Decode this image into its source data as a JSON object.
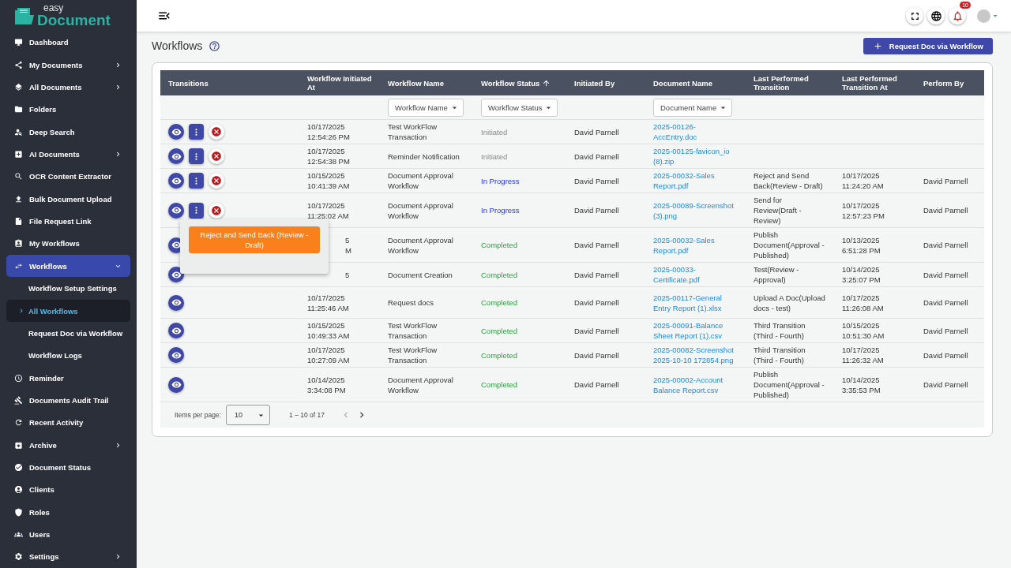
{
  "brand": {
    "small": "easy",
    "large": "Document"
  },
  "sidebar": {
    "items": [
      {
        "label": "Dashboard",
        "submenu": false
      },
      {
        "label": "My Documents",
        "submenu": true
      },
      {
        "label": "All Documents",
        "submenu": true
      },
      {
        "label": "Folders",
        "submenu": false
      },
      {
        "label": "Deep Search",
        "submenu": false
      },
      {
        "label": "AI Documents",
        "submenu": true
      },
      {
        "label": "OCR Content Extractor",
        "submenu": false
      },
      {
        "label": "Bulk Document Upload",
        "submenu": false
      },
      {
        "label": "File Request Link",
        "submenu": false
      },
      {
        "label": "My Workflows",
        "submenu": false
      },
      {
        "label": "Workflows",
        "submenu": true,
        "expanded": true,
        "children": [
          {
            "label": "Workflow Setup Settings",
            "selected": false
          },
          {
            "label": "All Workflows",
            "selected": true
          },
          {
            "label": "Request Doc via Workflow",
            "selected": false
          },
          {
            "label": "Workflow Logs",
            "selected": false
          }
        ]
      },
      {
        "label": "Reminder",
        "submenu": false
      },
      {
        "label": "Documents Audit Trail",
        "submenu": false
      },
      {
        "label": "Recent Activity",
        "submenu": false
      },
      {
        "label": "Archive",
        "submenu": true
      },
      {
        "label": "Document Status",
        "submenu": false
      },
      {
        "label": "Clients",
        "submenu": false
      },
      {
        "label": "Roles",
        "submenu": false
      },
      {
        "label": "Users",
        "submenu": false
      },
      {
        "label": "Settings",
        "submenu": true
      }
    ]
  },
  "topbar": {
    "notifications": "10"
  },
  "page": {
    "title": "Workflows",
    "action": "Request Doc via Workflow"
  },
  "table": {
    "columns": [
      {
        "label": "Transitions",
        "sorted": false
      },
      {
        "label": "Workflow Initiated At",
        "sorted": false
      },
      {
        "label": "Workflow Name",
        "sorted": false,
        "filter": "Workflow Name"
      },
      {
        "label": "Workflow Status",
        "sorted": true,
        "filter": "Workflow Status"
      },
      {
        "label": "Initiated By",
        "sorted": false
      },
      {
        "label": "Document Name",
        "sorted": false,
        "filter": "Document Name"
      },
      {
        "label": "Last Performed Transition",
        "sorted": false
      },
      {
        "label": "Last Performed Transition At",
        "sorted": false
      },
      {
        "label": "Perform By",
        "sorted": false
      }
    ],
    "rows": [
      {
        "transition": true,
        "cancel": true,
        "initiated_at": "10/17/2025 12:54:26 PM",
        "name": "Test WorkFlow Transaction",
        "status": "Initiated",
        "kind": "initiated",
        "by": "David Parnell",
        "document": "2025-00126-AccEntry.doc"
      },
      {
        "transition": true,
        "cancel": true,
        "initiated_at": "10/17/2025 12:54:38 PM",
        "name": "Reminder Notification",
        "status": "Initiated",
        "kind": "initiated",
        "by": "David Parnell",
        "document": "2025-00125-favicon_io (8).zip"
      },
      {
        "transition": true,
        "cancel": true,
        "initiated_at": "10/15/2025 10:41:39 AM",
        "name": "Document Approval Workflow",
        "status": "In Progress",
        "kind": "progress",
        "by": "David Parnell",
        "document": "2025-00032-Sales Report.pdf",
        "last": "Reject and Send Back(Review - Draft)",
        "last_at": "10/17/2025 11:24:20 AM",
        "perform_by": "David Parnell"
      },
      {
        "transition": true,
        "cancel": true,
        "menu_open": true,
        "menu": [
          "Reject and Send Back (Review - Draft)"
        ],
        "initiated_at": "10/17/2025 11:25:02 AM",
        "name": "Document Approval Workflow",
        "status": "In Progress",
        "kind": "progress",
        "by": "David Parnell",
        "document": "2025-00089-Screenshot (3).png",
        "last": "Send for Review(Draft - Review)",
        "last_at": "10/17/2025 12:57:23 PM",
        "perform_by": "David Parnell"
      },
      {
        "transition": false,
        "cancel": false,
        "covered": true,
        "initiated_at_parts": [
          "5",
          "M"
        ],
        "name": "Document Approval Workflow",
        "status": "Completed",
        "kind": "completed",
        "by": "David Parnell",
        "document": "2025-00032-Sales Report.pdf",
        "last": "Publish Document(Approval - Published)",
        "last_at": "10/13/2025 6:51:28 PM",
        "perform_by": "David Parnell"
      },
      {
        "transition": false,
        "cancel": false,
        "covered": true,
        "initiated_at_parts": [
          "5"
        ],
        "name": "Document Creation",
        "status": "Completed",
        "kind": "completed",
        "by": "David Parnell",
        "document": "2025-00033-Certificate.pdf",
        "last": "Test(Review - Approval)",
        "last_at": "10/14/2025 3:25:07 PM",
        "perform_by": "David Parnell"
      },
      {
        "transition": false,
        "cancel": false,
        "initiated_at": "10/17/2025 11:25:46 AM",
        "name": "Request docs",
        "status": "Completed",
        "kind": "completed",
        "by": "David Parnell",
        "document": "2025-00117-General Entry Report (1).xlsx",
        "last": "Upload A Doc(Upload docs - test)",
        "last_at": "10/17/2025 11:26:08 AM",
        "perform_by": "David Parnell"
      },
      {
        "transition": false,
        "cancel": false,
        "initiated_at": "10/15/2025 10:49:33 AM",
        "name": "Test WorkFlow Transaction",
        "status": "Completed",
        "kind": "completed",
        "by": "David Parnell",
        "document": "2025-00091-Balance Sheet Report (1).csv",
        "last": "Third Transition (Third - Fourth)",
        "last_at": "10/15/2025 10:51:30 AM",
        "perform_by": "David Parnell"
      },
      {
        "transition": false,
        "cancel": false,
        "initiated_at": "10/17/2025 10:27:09 AM",
        "name": "Test WorkFlow Transaction",
        "status": "Completed",
        "kind": "completed",
        "by": "David Parnell",
        "document": "2025-00082-Screenshot 2025-10-10 172854.png",
        "last": "Third Transition (Third - Fourth)",
        "last_at": "10/17/2025 11:26:32 AM",
        "perform_by": "David Parnell"
      },
      {
        "transition": false,
        "cancel": false,
        "initiated_at": "10/14/2025 3:34:08 PM",
        "name": "Document Approval Workflow",
        "status": "Completed",
        "kind": "completed",
        "by": "David Parnell",
        "document": "2025-00002-Account Balance Report.csv",
        "last": "Publish Document(Approval - Published)",
        "last_at": "10/14/2025 3:35:53 PM",
        "perform_by": "David Parnell"
      }
    ],
    "paginator": {
      "label": "Items per page:",
      "size": "10",
      "range": "1 – 10 of 17"
    }
  }
}
